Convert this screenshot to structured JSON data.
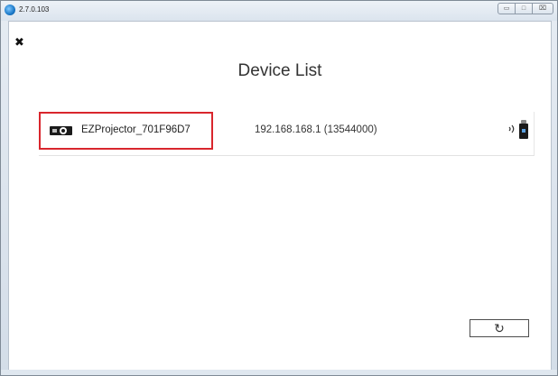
{
  "window": {
    "version": "2.7.0.103",
    "controls": {
      "minimize_glyph": "▭",
      "maximize_glyph": "□",
      "close_glyph": "⌧"
    }
  },
  "header": {
    "close_glyph": "✖",
    "title": "Device List"
  },
  "devices": [
    {
      "name": "EZProjector_701F96D7",
      "ip": "192.168.168.1 (13544000)",
      "icon": "projector-icon",
      "status_icons": [
        "wifi-signal-icon",
        "usb-dongle-icon"
      ],
      "selected": true
    }
  ],
  "footer": {
    "refresh_icon": "refresh-icon",
    "refresh_glyph": "↻"
  },
  "colors": {
    "highlight": "#d9262d",
    "accent": "#1a78c8"
  }
}
